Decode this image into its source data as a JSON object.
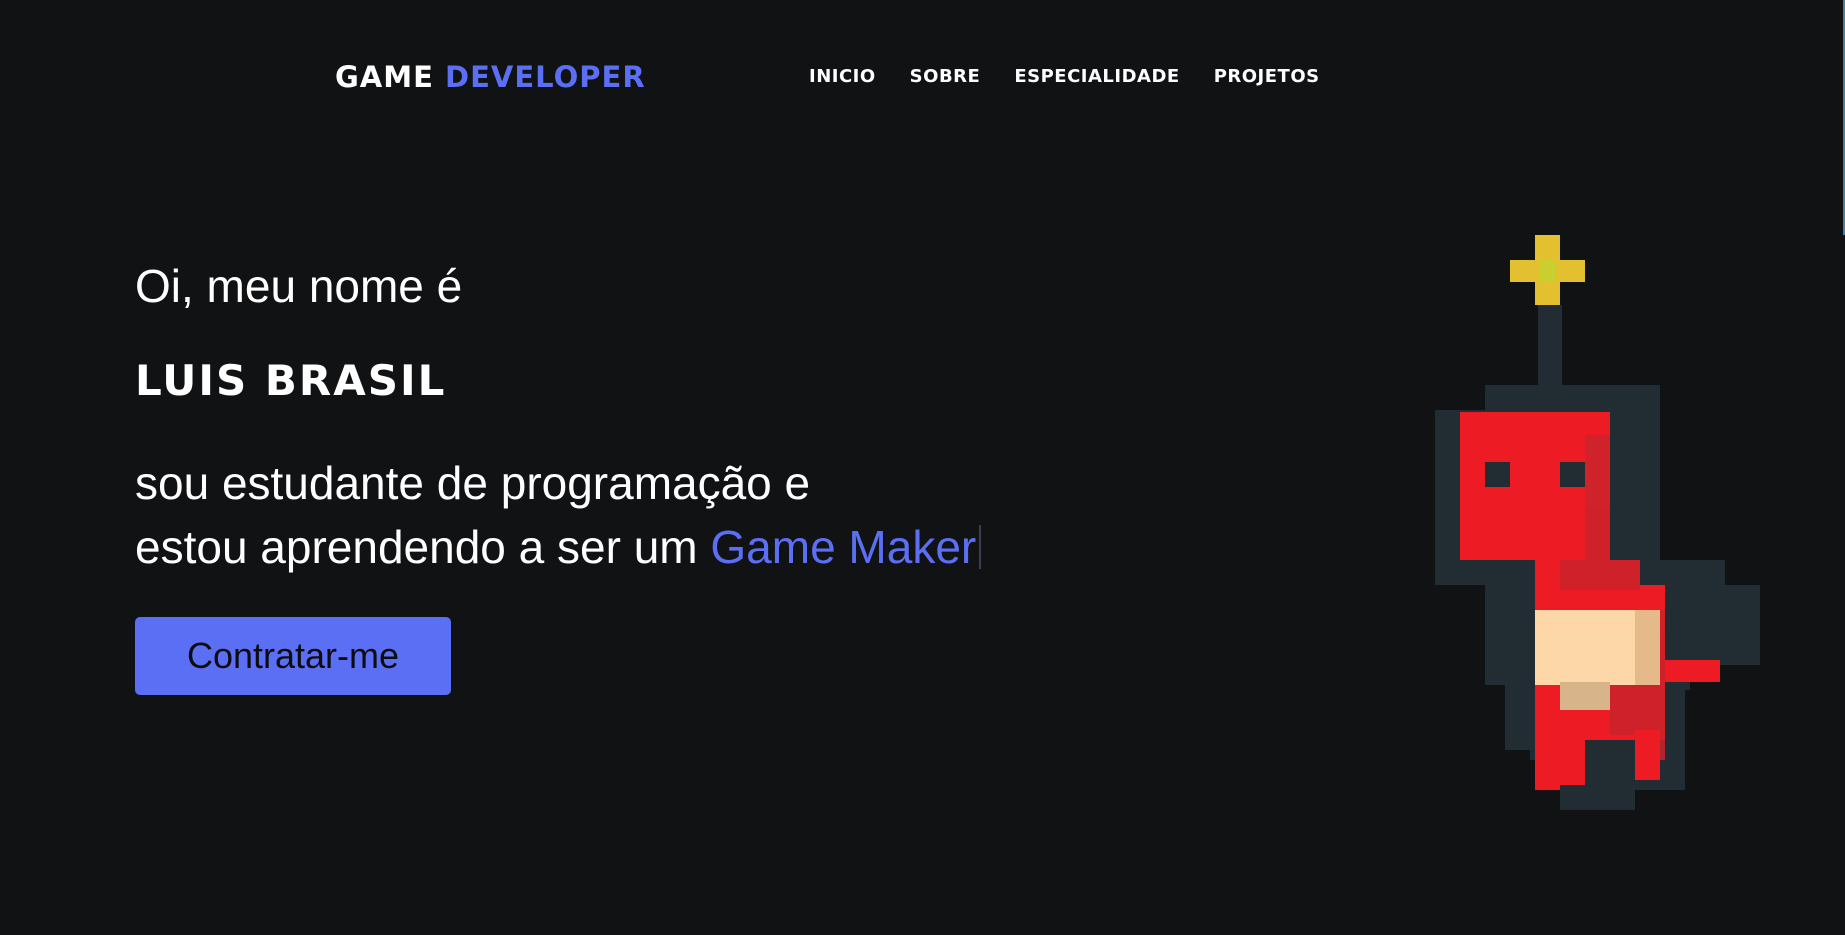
{
  "header": {
    "logo_word1": "GAME",
    "logo_word2": "DEVELOPER",
    "nav": [
      "INICIO",
      "SOBRE",
      "ESPECIALIDADE",
      "PROJETOS"
    ]
  },
  "hero": {
    "greeting": "Oi, meu nome é",
    "name": "LUIS BRASIL",
    "line1": "sou estudante de programação e",
    "line2_prefix": "estou aprendendo a ser um",
    "line2_accent": "Game Maker",
    "button_label": "Contratar-me"
  },
  "icons": {
    "character": "pixel-red-character-icon"
  },
  "colors": {
    "background": "#111214",
    "accent": "#5b6ff5",
    "character_red": "#ed1c24",
    "character_outline": "#222c33",
    "cross_yellow": "#e2c030",
    "skin": "#fdd7a8"
  }
}
